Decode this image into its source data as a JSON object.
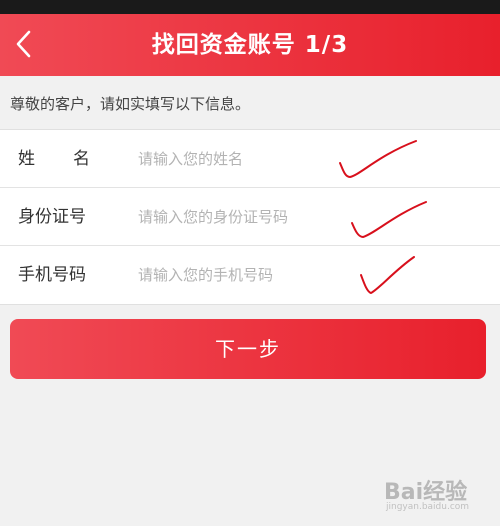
{
  "header": {
    "title": "找回资金账号 1/3",
    "back_icon": "chevron-left-icon"
  },
  "hint": "尊敬的客户，请如实填写以下信息。",
  "form": {
    "name": {
      "label": "姓名",
      "placeholder": "请输入您的姓名",
      "value": ""
    },
    "id_number": {
      "label": "身份证号",
      "placeholder": "请输入您的身份证号码",
      "value": ""
    },
    "phone": {
      "label": "手机号码",
      "placeholder": "请输入您的手机号码",
      "value": ""
    }
  },
  "next_button": {
    "label": "下一步"
  },
  "colors": {
    "accent": "#e8202c",
    "accent_light": "#f04a55",
    "check_mark": "#d8101c"
  },
  "watermark": {
    "brand": "Bai经验",
    "url": "jingyan.baidu.com"
  }
}
